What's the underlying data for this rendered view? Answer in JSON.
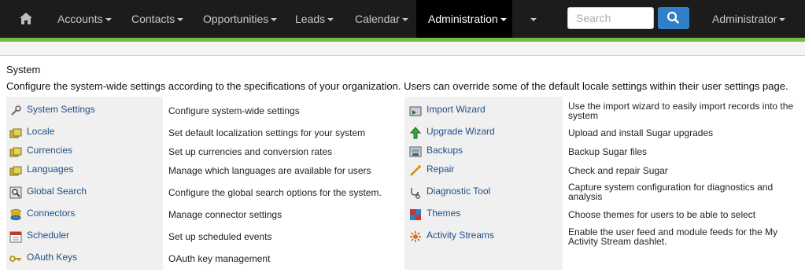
{
  "nav": {
    "home_icon": "home-icon",
    "items": [
      {
        "label": "Accounts"
      },
      {
        "label": "Contacts"
      },
      {
        "label": "Opportunities"
      },
      {
        "label": "Leads"
      },
      {
        "label": "Calendar"
      },
      {
        "label": "Administration"
      }
    ],
    "search_placeholder": "Search",
    "user": "Administrator"
  },
  "section": {
    "title": "System",
    "description": "Configure the system-wide settings according to the specifications of your organization. Users can override some of the default locale settings within their user settings page."
  },
  "left": [
    {
      "label": "System Settings",
      "desc": "Configure system-wide settings",
      "icon": "wrench-icon"
    },
    {
      "label": "Locale",
      "desc": "Set default localization settings for your system",
      "icon": "money-icon"
    },
    {
      "label": "Currencies",
      "desc": "Set up currencies and conversion rates",
      "icon": "money-icon"
    },
    {
      "label": "Languages",
      "desc": "Manage which languages are available for users",
      "icon": "money-icon"
    },
    {
      "label": "Global Search",
      "desc": "Configure the global search options for the system.",
      "icon": "magnifier-icon"
    },
    {
      "label": "Connectors",
      "desc": "Manage connector settings",
      "icon": "database-icon"
    },
    {
      "label": "Scheduler",
      "desc": "Set up scheduled events",
      "icon": "calendar-icon"
    },
    {
      "label": "OAuth Keys",
      "desc": "OAuth key management",
      "icon": "key-icon"
    }
  ],
  "right": [
    {
      "label": "Import Wizard",
      "desc": "Use the import wizard to easily import records into the system",
      "icon": "import-icon"
    },
    {
      "label": "Upgrade Wizard",
      "desc": "Upload and install Sugar upgrades",
      "icon": "up-arrow-icon"
    },
    {
      "label": "Backups",
      "desc": "Backup Sugar files",
      "icon": "backup-icon"
    },
    {
      "label": "Repair",
      "desc": "Check and repair Sugar",
      "icon": "repair-icon"
    },
    {
      "label": "Diagnostic Tool",
      "desc": "Capture system configuration for diagnostics and analysis",
      "icon": "stethoscope-icon"
    },
    {
      "label": "Themes",
      "desc": "Choose themes for users to be able to select",
      "icon": "themes-icon"
    },
    {
      "label": "Activity Streams",
      "desc": "Enable the user feed and module feeds for the My Activity Stream dashlet.",
      "icon": "activity-icon"
    }
  ]
}
